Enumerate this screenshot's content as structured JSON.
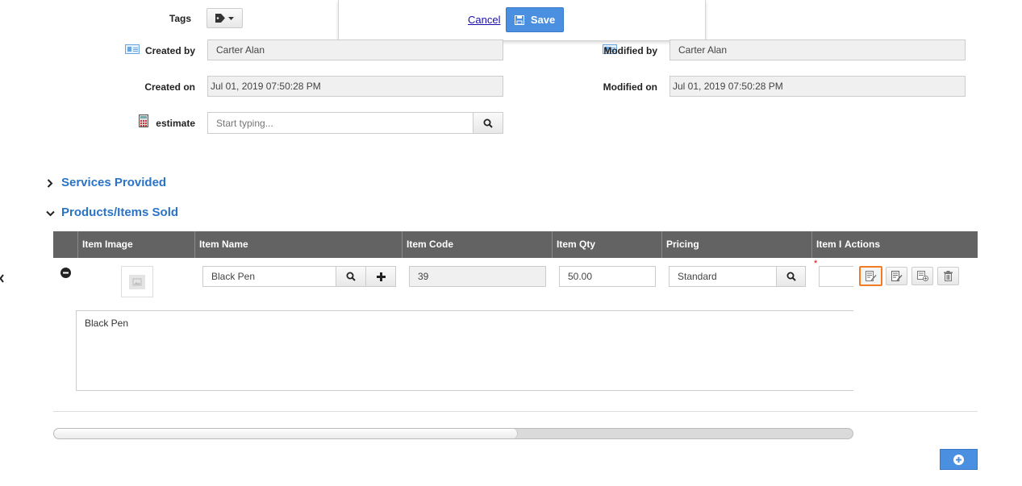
{
  "dialog": {
    "cancel_label": "Cancel",
    "save_label": "Save"
  },
  "form": {
    "tags_label": "Tags",
    "created_by_label": "Created by",
    "created_by_value": "Carter Alan",
    "modified_by_label": "Modified by",
    "modified_by_value": "Carter Alan",
    "created_on_label": "Created on",
    "created_on_value": "Jul 01, 2019 07:50:28 PM",
    "modified_on_label": "Modified on",
    "modified_on_value": "Jul 01, 2019 07:50:28 PM",
    "estimate_label": "estimate",
    "estimate_placeholder": "Start typing..."
  },
  "sections": {
    "services_title": "Services Provided",
    "products_title": "Products/Items Sold"
  },
  "table": {
    "headers": [
      "Item Image",
      "Item Name",
      "Item Code",
      "Item Qty",
      "Pricing",
      "Item I",
      "Actions"
    ],
    "row": {
      "item_name": "Black Pen",
      "item_code": "39",
      "item_qty": "50.00",
      "pricing": "Standard",
      "description": "Black Pen",
      "required_marker": "*"
    }
  },
  "scrollbar": {
    "position": 0.58
  },
  "colors": {
    "accent": "#2a73c5",
    "primary_button": "#4a8fe0",
    "header_bg": "#636363",
    "focus": "#f07c24"
  }
}
